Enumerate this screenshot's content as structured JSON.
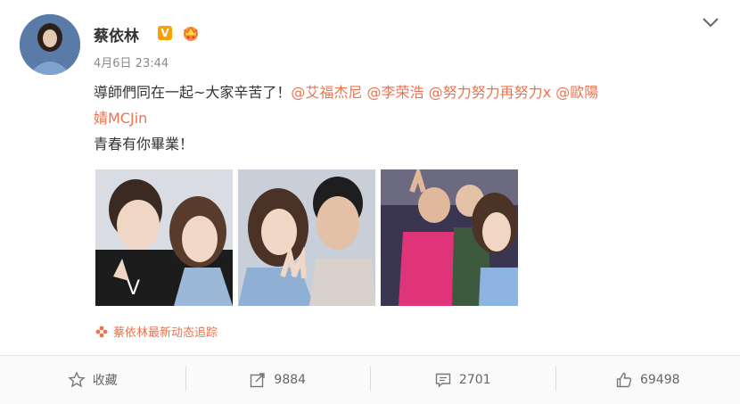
{
  "post": {
    "author": "蔡依林",
    "verified_badge": "V",
    "timestamp": "4月6日 23:44",
    "text": {
      "before": "導師們同在一起~大家辛苦了！",
      "mentions": [
        "@艾福杰尼",
        "@李荣浩",
        "@努力努力再努力x",
        "@歐陽"
      ],
      "line2": "婧MCJin",
      "line3": "青春有你畢業！"
    },
    "photos": [
      {
        "icon": "photo-1"
      },
      {
        "icon": "photo-2"
      },
      {
        "icon": "photo-3"
      }
    ],
    "tracking_link": "蔡依林最新动态追踪"
  },
  "actions": {
    "favorite_label": "收藏",
    "repost_count": "9884",
    "comment_count": "2701",
    "like_count": "69498"
  },
  "colors": {
    "accent": "#eb7350",
    "badge": "#f7a200",
    "text": "#333333",
    "muted": "#8a8a8a"
  }
}
